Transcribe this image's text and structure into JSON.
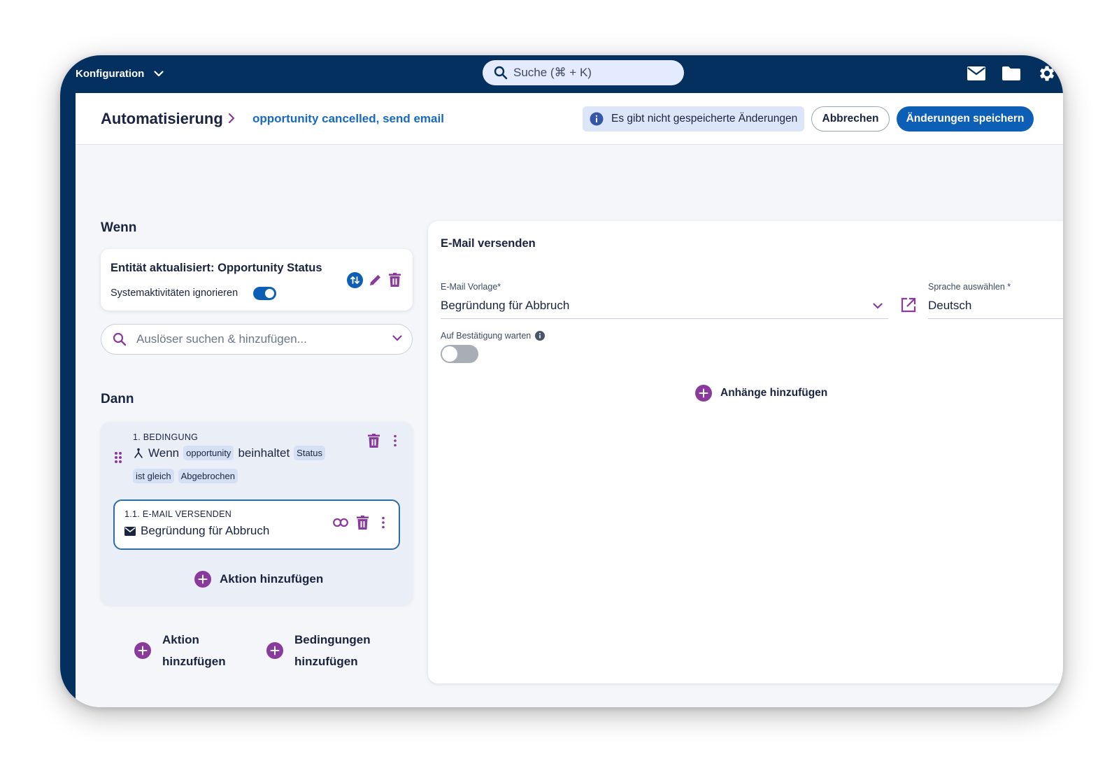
{
  "topbar": {
    "menu_label": "Konfiguration",
    "search_placeholder": "Suche (⌘ + K)",
    "icons": [
      "mail-icon",
      "folder-icon",
      "gear-icon"
    ]
  },
  "header": {
    "title": "Automatisierung",
    "breadcrumb_current": "opportunity cancelled, send email",
    "unsaved_message": "Es gibt nicht gespeicherte Änderungen",
    "cancel_label": "Abbrechen",
    "save_label": "Änderungen speichern"
  },
  "when": {
    "section_title": "Wenn",
    "trigger_title": "Entität aktualisiert: Opportunity Status",
    "ignore_system_label": "Systemaktivitäten ignorieren",
    "ignore_system_enabled": true,
    "search_placeholder": "Auslöser suchen & hinzufügen..."
  },
  "then": {
    "section_title": "Dann",
    "condition": {
      "number_label": "1. BEDINGUNG",
      "word_if": "Wenn",
      "chip_entity": "opportunity",
      "word_contains": "beinhaltet",
      "chip_field": "Status",
      "chip_operator": "ist gleich",
      "chip_value": "Abgebrochen"
    },
    "action": {
      "number_label": "1.1. E-MAIL VERSENDEN",
      "title": "Begründung für Abbruch"
    },
    "add_action_inner": "Aktion hinzufügen",
    "add_action_line1": "Aktion",
    "add_action_line2": "hinzufügen",
    "add_condition_line1": "Bedingungen",
    "add_condition_line2": "hinzufügen"
  },
  "detail": {
    "title": "E-Mail versenden",
    "template_label": "E-Mail Vorlage*",
    "template_value": "Begründung für Abbruch",
    "language_label": "Sprache auswählen *",
    "language_value": "Deutsch",
    "wait_label": "Auf Bestätigung warten",
    "wait_enabled": false,
    "add_attachments": "Anhänge hinzufügen"
  },
  "colors": {
    "navy": "#03305e",
    "primary": "#0d5fb5",
    "purple": "#8a3a9c",
    "link": "#1769c2"
  }
}
